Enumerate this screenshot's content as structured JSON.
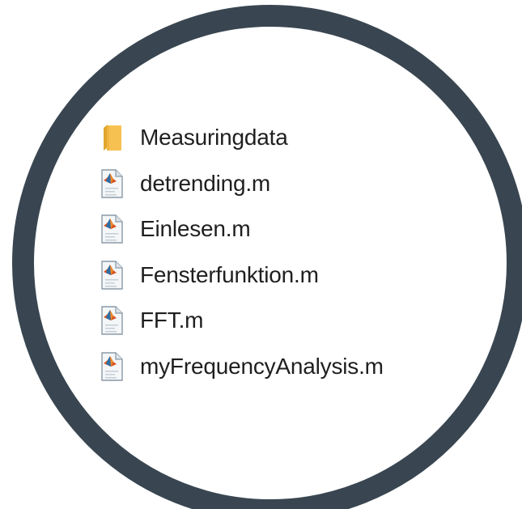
{
  "colors": {
    "ring": "#394651",
    "folder": "#f6c150",
    "text": "#1f1f1f"
  },
  "files": [
    {
      "name": "Measuringdata",
      "type": "folder",
      "icon": "folder-icon"
    },
    {
      "name": "detrending.m",
      "type": "matlab-file",
      "icon": "matlab-file-icon"
    },
    {
      "name": "Einlesen.m",
      "type": "matlab-file",
      "icon": "matlab-file-icon"
    },
    {
      "name": "Fensterfunktion.m",
      "type": "matlab-file",
      "icon": "matlab-file-icon"
    },
    {
      "name": "FFT.m",
      "type": "matlab-file",
      "icon": "matlab-file-icon"
    },
    {
      "name": "myFrequencyAnalysis.m",
      "type": "matlab-file",
      "icon": "matlab-file-icon"
    }
  ]
}
